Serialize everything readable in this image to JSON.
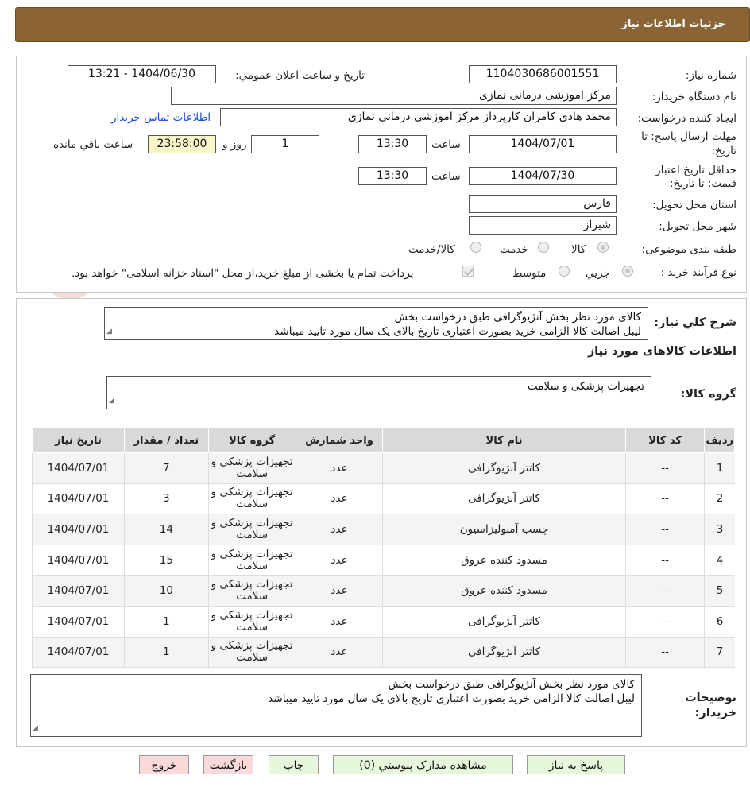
{
  "header": {
    "title": "جزئیات اطلاعات نیاز"
  },
  "watermark": {
    "brand": "AriaTender.neT"
  },
  "form": {
    "need_number_label": "شماره نیاز:",
    "need_number": "1104030686001551",
    "announce_label": "تاریخ و ساعت اعلان عمومي:",
    "announce_value": "1404/06/30 - 13:21",
    "buyer_org_label": "نام دستگاه خريدار:",
    "buyer_org": "مرکز اموزشی درمانی نمازی",
    "creator_label": "ايجاد کننده درخواست:",
    "creator": "محمد هادی کامران کارپرداز مرکز اموزشی درمانی نمازی",
    "contact_link": "اطلاعات تماس خريدار",
    "deadline_label_1": "مهلت ارسال پاسخ: تا",
    "deadline_label_2": "تاريخ:",
    "deadline_date": "1404/07/01",
    "time_label": "ساعت",
    "deadline_time": "13:30",
    "days_value": "1",
    "days_label": "روز و",
    "remaining_time": "23:58:00",
    "remaining_label": "ساعت باقي مانده",
    "validity_label_1": "حداقل تاريخ اعتبار",
    "validity_label_2": "قيمت: تا تاريخ:",
    "validity_date": "1404/07/30",
    "validity_time": "13:30",
    "province_label": "استان محل تحويل:",
    "province": "فارس",
    "city_label": "شهر محل تحويل:",
    "city": "شیراز",
    "category_label": "طبقه بندی موضوعی:",
    "category_goods": "کالا",
    "category_service": "خدمت",
    "category_both": "کالا/خدمت",
    "process_label": "نوع فرآيند خريد :",
    "process_partial": "جزيي",
    "process_medium": "متوسط",
    "payment_note": "پرداخت تمام يا بخشی از مبلغ خريد،از محل \"اسناد خزانه اسلامی\" خواهد بود."
  },
  "summary": {
    "label": "شرح کلي نياز:",
    "line1": "کالای مورد نظر بخش آنژیوگرافی طبق درخواست بخش",
    "line2": "لیبل اصالت کالا الزامی خرید بصورت اعتباری تاریخ بالای یک سال مورد تایید میباشد"
  },
  "goods_section": {
    "title": "اطلاعات کالاهای مورد نیاز",
    "group_label": "گروه کالا:",
    "group_value": "تجهیزات پزشکی و سلامت"
  },
  "table": {
    "headers": [
      "رديف",
      "کد کالا",
      "نام کالا",
      "واحد شمارش",
      "گروه کالا",
      "تعداد / مقدار",
      "تاريخ نياز"
    ],
    "rows": [
      [
        "1",
        "--",
        "کاتتر آنژیوگرافی",
        "عدد",
        "تجهیزات پزشکی و سلامت",
        "7",
        "1404/07/01"
      ],
      [
        "2",
        "--",
        "کاتتر آنژیوگرافی",
        "عدد",
        "تجهیزات پزشکی و سلامت",
        "3",
        "1404/07/01"
      ],
      [
        "3",
        "--",
        "چسب آمبولیزاسیون",
        "عدد",
        "تجهیزات پزشکی و سلامت",
        "14",
        "1404/07/01"
      ],
      [
        "4",
        "--",
        "مسدود کننده عروق",
        "عدد",
        "تجهیزات پزشکی و سلامت",
        "15",
        "1404/07/01"
      ],
      [
        "5",
        "--",
        "مسدود کننده عروق",
        "عدد",
        "تجهیزات پزشکی و سلامت",
        "10",
        "1404/07/01"
      ],
      [
        "6",
        "--",
        "کاتتر آنژیوگرافی",
        "عدد",
        "تجهیزات پزشکی و سلامت",
        "1",
        "1404/07/01"
      ],
      [
        "7",
        "--",
        "کاتتر آنژیوگرافی",
        "عدد",
        "تجهیزات پزشکی و سلامت",
        "1",
        "1404/07/01"
      ]
    ]
  },
  "buyer_notes": {
    "label_1": "توضیحات",
    "label_2": "خریدار:",
    "line1": "کالای مورد نظر بخش آنژیوگرافی طبق درخواست بخش",
    "line2": "لیبل اصالت کالا الزامی خرید بصورت اعتباری تاریخ بالای یک سال مورد تایید میباشد"
  },
  "buttons": {
    "reply": "پاسخ به نياز",
    "attachments": "مشاهده مدارک پيوستي (0)",
    "print": "چاپ",
    "back": "بازگشت",
    "exit": "خروج"
  },
  "colors": {
    "header_bg": "#8a6434",
    "link": "#1a4fd0",
    "button_green": "#e6f7dc",
    "button_pink": "#f9d9d9",
    "highlight_yellow": "#f8f5c9"
  }
}
